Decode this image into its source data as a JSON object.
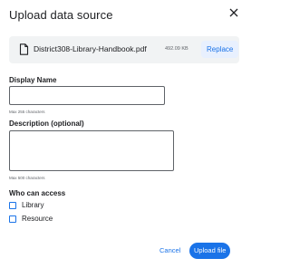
{
  "dialog": {
    "title": "Upload data source",
    "close_icon": "close-icon"
  },
  "file": {
    "icon": "file-icon",
    "name": "District308-Library-Handbook.pdf",
    "size": "492.09 KB",
    "replace_label": "Replace"
  },
  "display_name": {
    "label": "Display Name",
    "value": "",
    "hint": "Max 255 characters"
  },
  "description": {
    "label": "Description (optional)",
    "value": "",
    "hint": "Max 500 characters"
  },
  "access": {
    "label": "Who can access",
    "options": [
      {
        "label": "Library",
        "checked": false
      },
      {
        "label": "Resource",
        "checked": false
      }
    ]
  },
  "actions": {
    "cancel_label": "Cancel",
    "upload_label": "Upload file"
  },
  "colors": {
    "accent": "#1a73e8",
    "file_box_bg": "#f1f3f4",
    "replace_bg": "#e8f0fe"
  }
}
